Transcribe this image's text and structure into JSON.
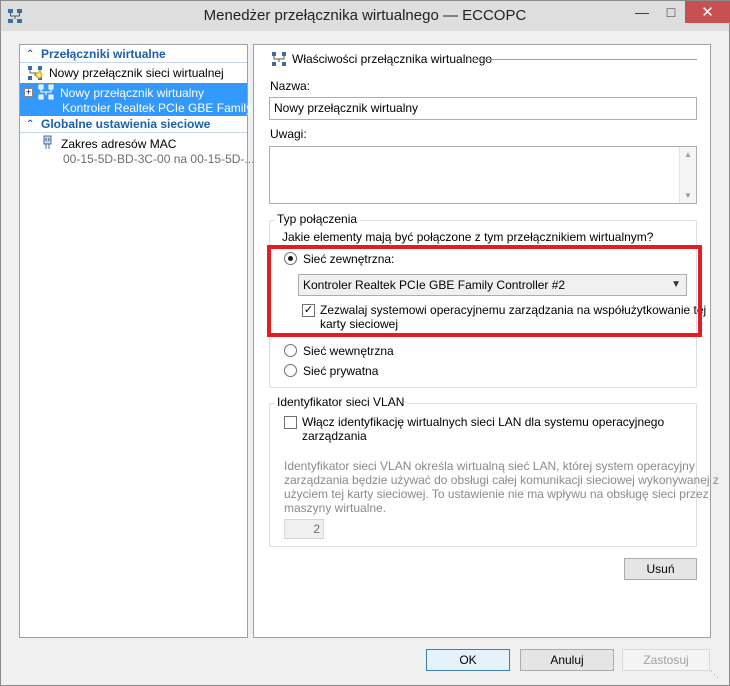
{
  "window": {
    "title": "Menedżer przełącznika wirtualnego — ECCOPC",
    "minimize_icon": "minimize-icon",
    "maximize_icon": "maximize-icon",
    "close_icon": "close-icon"
  },
  "tree": {
    "section_switches": "Przełączniki wirtualne",
    "new_switch": "Nowy przełącznik sieci wirtualnej",
    "selected_switch_name": "Nowy przełącznik wirtualny",
    "selected_switch_adapter": "Kontroler Realtek PCIe GBE Family ...",
    "section_global": "Globalne ustawienia sieciowe",
    "mac_range_label": "Zakres adresów MAC",
    "mac_range_value": "00-15-5D-BD-3C-00 na 00-15-5D-..."
  },
  "properties": {
    "header": "Właściwości przełącznika wirtualnego",
    "name_label": "Nazwa:",
    "name_value": "Nowy przełącznik wirtualny",
    "notes_label": "Uwagi:",
    "notes_value": "",
    "connection_group": "Typ połączenia",
    "connection_question": "Jakie elementy mają być połączone z tym przełącznikiem wirtualnym?",
    "external_label": "Sieć zewnętrzna:",
    "external_adapter": "Kontroler Realtek PCIe GBE Family Controller #2",
    "allow_os_line1": "Zezwalaj systemowi operacyjnemu zarządzania na współużytkowanie tej",
    "allow_os_line2": "karty sieciowej",
    "internal_label": "Sieć wewnętrzna",
    "private_label": "Sieć prywatna",
    "vlan_group": "Identyfikator sieci VLAN",
    "vlan_enable_line1": "Włącz identyfikację wirtualnych sieci LAN dla systemu operacyjnego",
    "vlan_enable_line2": "zarządzania",
    "vlan_desc_line1": "Identyfikator sieci VLAN określa wirtualną sieć LAN, której system operacyjny",
    "vlan_desc_line2": "zarządzania będzie używać do obsługi całej komunikacji sieciowej wykonywanej z",
    "vlan_desc_line3": "użyciem tej karty sieciowej. To ustawienie nie ma wpływu na obsługę sieci przez",
    "vlan_desc_line4": "maszyny wirtualne.",
    "vlan_id": "2",
    "remove_button": "Usuń"
  },
  "footer": {
    "ok": "OK",
    "cancel": "Anuluj",
    "apply": "Zastosuj"
  }
}
